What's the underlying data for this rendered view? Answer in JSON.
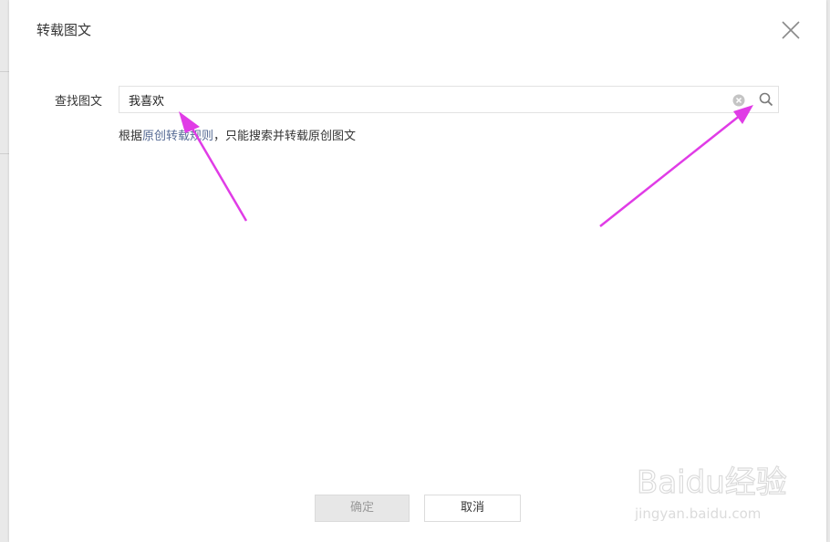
{
  "dialog": {
    "title": "转载图文"
  },
  "search": {
    "label": "查找图文",
    "value": "我喜欢",
    "clear_icon": "clear-circle-icon",
    "search_icon": "search-icon"
  },
  "hint": {
    "prefix": "根据",
    "link_text": "原创转载规则",
    "suffix": "，只能搜索并转载原创图文"
  },
  "footer": {
    "ok_label": "确定",
    "cancel_label": "取消"
  },
  "watermark": {
    "brand": "Baidu经验",
    "url": "jingyan.baidu.com"
  },
  "colors": {
    "link": "#576b95",
    "arrow": "#e03ce6",
    "disabled_button_bg": "#e7e7e7"
  }
}
